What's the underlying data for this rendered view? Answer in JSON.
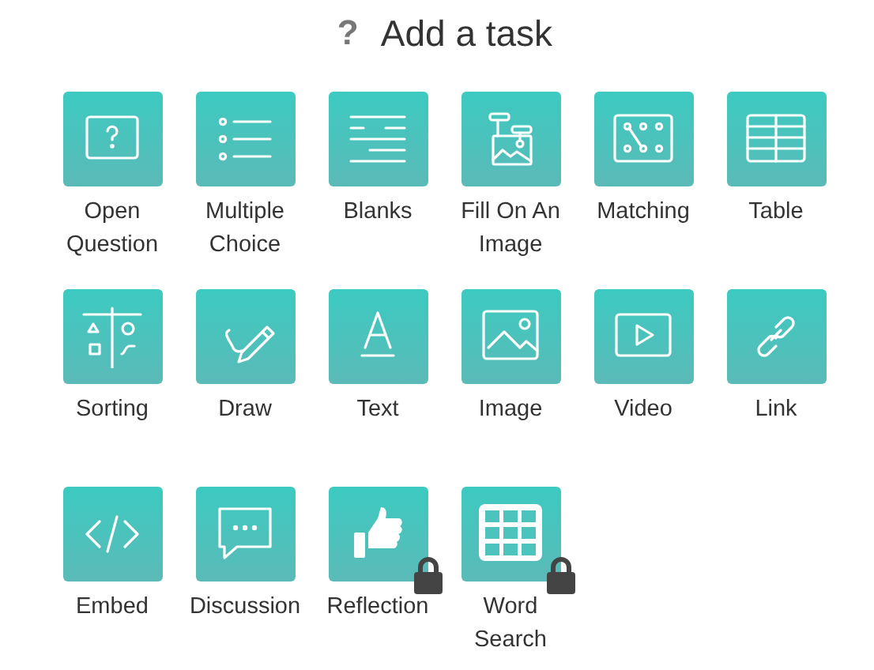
{
  "header": {
    "help_icon": "?",
    "title": "Add a task"
  },
  "tasks": [
    {
      "label": "Open Question",
      "kind": "open",
      "locked": false
    },
    {
      "label": "Multiple Choice",
      "kind": "choice",
      "locked": false
    },
    {
      "label": "Blanks",
      "kind": "blanks",
      "locked": false
    },
    {
      "label": "Fill On An Image",
      "kind": "fillimage",
      "locked": false
    },
    {
      "label": "Matching",
      "kind": "matching",
      "locked": false
    },
    {
      "label": "Table",
      "kind": "table",
      "locked": false
    },
    {
      "label": "Sorting",
      "kind": "sorting",
      "locked": false
    },
    {
      "label": "Draw",
      "kind": "draw",
      "locked": false
    },
    {
      "label": "Text",
      "kind": "text",
      "locked": false
    },
    {
      "label": "Image",
      "kind": "image",
      "locked": false
    },
    {
      "label": "Video",
      "kind": "video",
      "locked": false
    },
    {
      "label": "Link",
      "kind": "link",
      "locked": false
    },
    {
      "label": "Embed",
      "kind": "embed",
      "locked": false
    },
    {
      "label": "Discussion",
      "kind": "discussion",
      "locked": false
    },
    {
      "label": "Reflection",
      "kind": "reflection",
      "locked": true
    },
    {
      "label": "Word Search",
      "kind": "wordsearch",
      "locked": true
    }
  ]
}
